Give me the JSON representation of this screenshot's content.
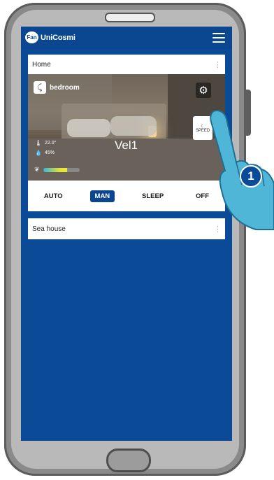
{
  "app": {
    "brand_badge": "Fan",
    "brand_name": "UniCosmi"
  },
  "home_card": {
    "title": "Home",
    "more_icon": "⋮",
    "room": {
      "name": "bedroom",
      "temperature": "22.0°",
      "humidity": "45%",
      "speed": "Vel1",
      "mode_card_label": "SPEED"
    },
    "modes": [
      {
        "label": "AUTO",
        "active": false
      },
      {
        "label": "MAN",
        "active": true
      },
      {
        "label": "SLEEP",
        "active": false
      },
      {
        "label": "OFF",
        "active": false
      }
    ]
  },
  "sea_card": {
    "title": "Sea house",
    "more_icon": "⋮"
  },
  "step": {
    "number": "1"
  },
  "colors": {
    "primary": "#0b4690",
    "screen": "#0a4a97",
    "card": "#ffffff",
    "phone_frame": "#8a8a8a",
    "hand": "#4fb6d8"
  },
  "icons": {
    "menu": "hamburger-menu-icon",
    "gear": "gear-icon",
    "thermometer": "thermometer-icon",
    "humidity": "water-drop-icon",
    "leaf": "leaf-icon",
    "fan": "fan-icon"
  }
}
